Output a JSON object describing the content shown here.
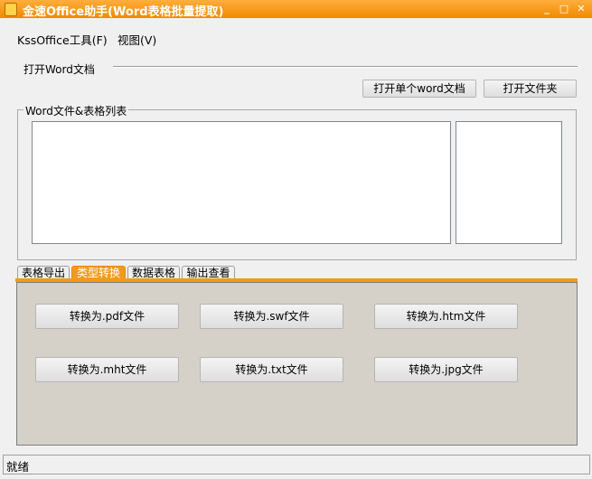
{
  "window": {
    "title": "金速Office助手(Word表格批量提取)",
    "controls": {
      "minimize": "_",
      "maximize": "□",
      "close": "✕"
    }
  },
  "menubar": {
    "items": [
      {
        "label": "KssOffice工具(F)"
      },
      {
        "label": "视图(V)"
      }
    ]
  },
  "open_section": {
    "label": "打开Word文档",
    "open_single_button": "打开单个word文档",
    "open_folder_button": "打开文件夹"
  },
  "file_list": {
    "legend": "Word文件&表格列表"
  },
  "tabs": {
    "items": [
      {
        "label": "表格导出"
      },
      {
        "label": "类型转换"
      },
      {
        "label": "数据表格"
      },
      {
        "label": "输出查看"
      }
    ],
    "active_index": 1,
    "accent_color": "#f39a1e"
  },
  "convert_panel": {
    "buttons": [
      {
        "label": "转换为.pdf文件"
      },
      {
        "label": "转换为.swf文件"
      },
      {
        "label": "转换为.htm文件"
      },
      {
        "label": "转换为.mht文件"
      },
      {
        "label": "转换为.txt文件"
      },
      {
        "label": "转换为.jpg文件"
      }
    ]
  },
  "statusbar": {
    "text": "就绪"
  }
}
